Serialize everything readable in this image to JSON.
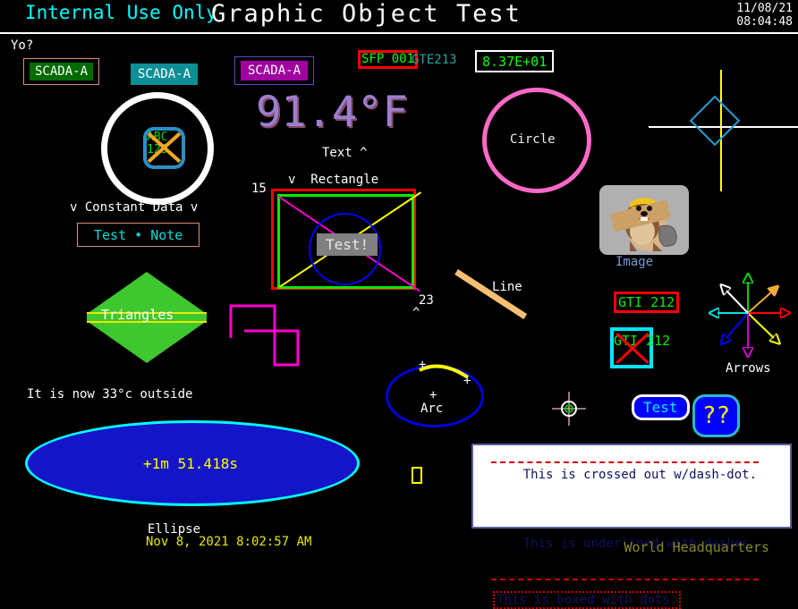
{
  "header": {
    "internal_label": "Internal Use Only",
    "title": "Graphic Object Test",
    "date": "11/08/21",
    "time": "08:04:48"
  },
  "annotations": {
    "yo": "Yo?",
    "headquarters": "World Headquarters"
  },
  "tags": {
    "scada_a": "SCADA-A",
    "scada_b": "SCADA-A",
    "scada_c": "SCADA-A",
    "sfp": "SFP\n001",
    "gte_label": "GTE213",
    "gte_value": "8.37E+01",
    "gti_1": "GTI\n212",
    "gti_2": "GTI\n212"
  },
  "temperature": {
    "value": "91.4°F",
    "outside_text": "It is now 33°c outside"
  },
  "circle_object": {
    "inner_text": "ABC\n123",
    "constant_data_label": "v Constant Data v",
    "note": "Test • Note"
  },
  "rectangle_object": {
    "label": "v  Rectangle",
    "text_caret": "Text ^",
    "value_left": "15",
    "value_right": "23",
    "caret_bottom": "^",
    "center_text": "Test!"
  },
  "pink_circle": {
    "label": "Circle"
  },
  "image_object": {
    "caption": "Image",
    "alt": "beaver-with-hardhat-carrying-lumber"
  },
  "triangles": {
    "label": "Triangles"
  },
  "line_object": {
    "label": "Line"
  },
  "arrows": {
    "label": "Arrows"
  },
  "arc_object": {
    "label": "Arc",
    "markers": [
      "+",
      "+",
      "+"
    ]
  },
  "buttons": {
    "test_pill": "Test",
    "question": "??"
  },
  "ellipse_object": {
    "value": "+1m 51.418s",
    "label": "Ellipse",
    "date": "Nov 8, 2021  8:02:57 AM"
  },
  "decorated_text": {
    "line1": "This is crossed out w/dash-dot.",
    "line2": "This is underlined with dashes.",
    "line3": "This is boxed with dots."
  },
  "colors": {
    "background": "#000000",
    "cyan": "#00ffff",
    "green": "#00ff00",
    "red": "#ff0000",
    "magenta": "#ff00d0",
    "yellow": "#ffff00",
    "pink": "#ff69c8",
    "blue": "#0000ff",
    "purple": "#9a7fd1",
    "orange": "#f7bf72"
  }
}
